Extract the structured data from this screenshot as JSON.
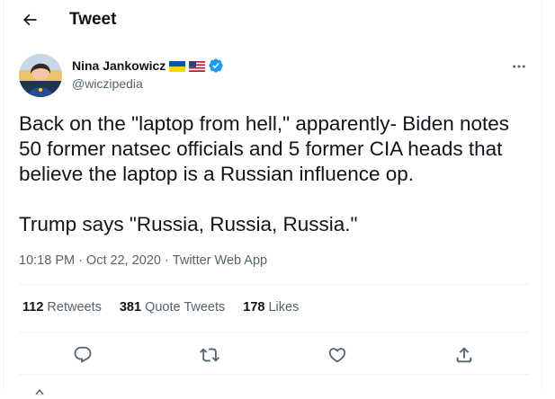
{
  "header": {
    "title": "Tweet"
  },
  "author": {
    "display_name": "Nina Jankowicz",
    "handle": "@wiczipedia"
  },
  "tweet": {
    "text": "Back on the \"laptop from hell,\" apparently- Biden notes 50 former natsec officials and 5 former CIA heads that believe the laptop is a Russian influence op.\n\nTrump says \"Russia, Russia, Russia.\""
  },
  "meta": {
    "time": "10:18 PM",
    "date": "Oct 22, 2020",
    "source": "Twitter Web App",
    "separator": "·"
  },
  "stats": [
    {
      "count": "112",
      "label": "Retweets"
    },
    {
      "count": "381",
      "label": "Quote Tweets"
    },
    {
      "count": "178",
      "label": "Likes"
    }
  ],
  "icons": {
    "back": "arrow-left-icon",
    "more": "more-horizontal-icon",
    "reply": "reply-icon",
    "retweet": "retweet-icon",
    "like": "heart-icon",
    "share": "share-icon",
    "verified": "verified-badge-icon",
    "flags": [
      "ukraine-flag-icon",
      "us-flag-icon"
    ]
  },
  "colors": {
    "accent": "#1d9bf0",
    "secondary_text": "#536471",
    "border": "#eff3f4"
  }
}
